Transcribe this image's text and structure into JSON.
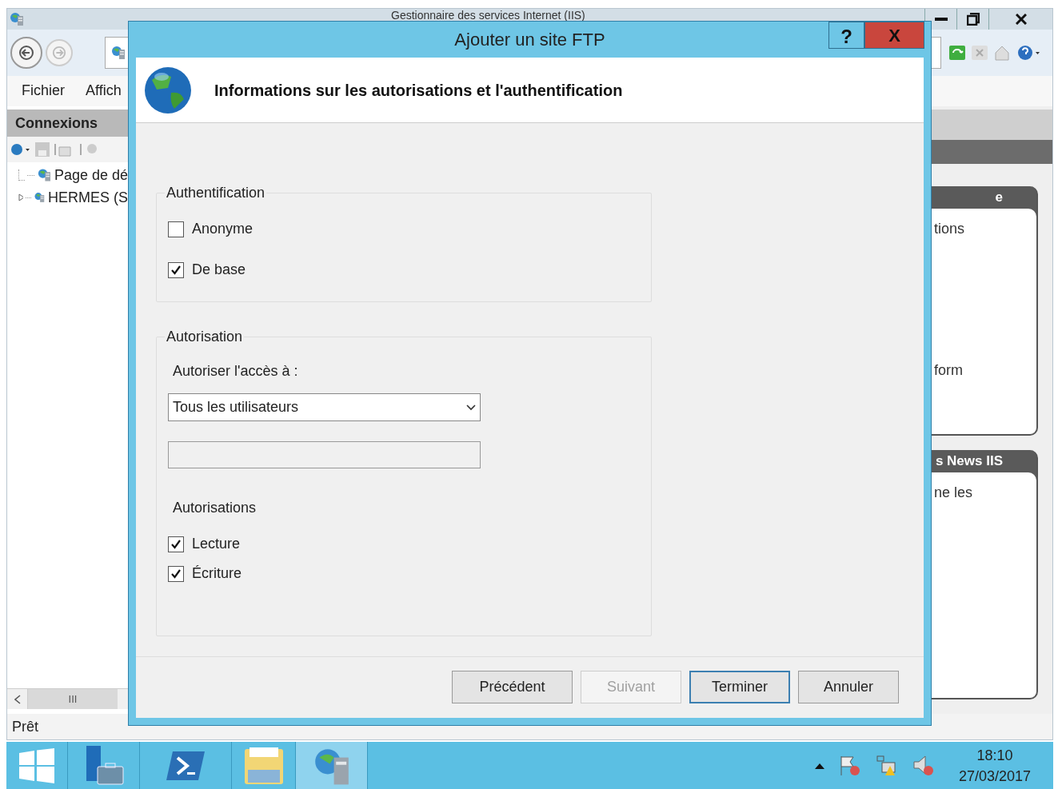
{
  "main_window": {
    "title": "Gestionnaire des services Internet (IIS)",
    "menu": [
      "Fichier",
      "Affich"
    ],
    "connections": {
      "title": "Connexions",
      "tree": [
        {
          "label": "Page de dé",
          "kind": "leaf"
        },
        {
          "label": "HERMES (S",
          "kind": "node"
        }
      ]
    },
    "scrollbar_grip": "III",
    "actions": [
      {
        "header": "e",
        "items": [
          "tions",
          "form"
        ]
      },
      {
        "header": "s News IIS",
        "items": [
          "ne les"
        ]
      }
    ],
    "status": "Prêt"
  },
  "dialog": {
    "title": "Ajouter un site FTP",
    "help": "?",
    "close": "X",
    "heading": "Informations sur les autorisations et l'authentification",
    "authentication": {
      "legend": "Authentification",
      "options": [
        {
          "label": "Anonyme",
          "checked": false
        },
        {
          "label": "De base",
          "checked": true
        }
      ]
    },
    "authorization": {
      "legend": "Autorisation",
      "access_label": "Autoriser l'accès à :",
      "access_value": "Tous les utilisateurs",
      "permissions_label": "Autorisations",
      "permissions": [
        {
          "label": "Lecture",
          "checked": true
        },
        {
          "label": "Écriture",
          "checked": true
        }
      ]
    },
    "buttons": [
      {
        "label": "Précédent",
        "disabled": false,
        "default": false
      },
      {
        "label": "Suivant",
        "disabled": true,
        "default": false
      },
      {
        "label": "Terminer",
        "disabled": false,
        "default": true
      },
      {
        "label": "Annuler",
        "disabled": false,
        "default": false
      }
    ]
  },
  "taskbar": {
    "apps": [
      {
        "kind": "start",
        "selected": false
      },
      {
        "kind": "server",
        "selected": false
      },
      {
        "kind": "shell",
        "selected": false
      },
      {
        "kind": "folder",
        "selected": false
      },
      {
        "kind": "iis",
        "selected": true
      }
    ],
    "time": "18:10",
    "date": "27/03/2017"
  }
}
